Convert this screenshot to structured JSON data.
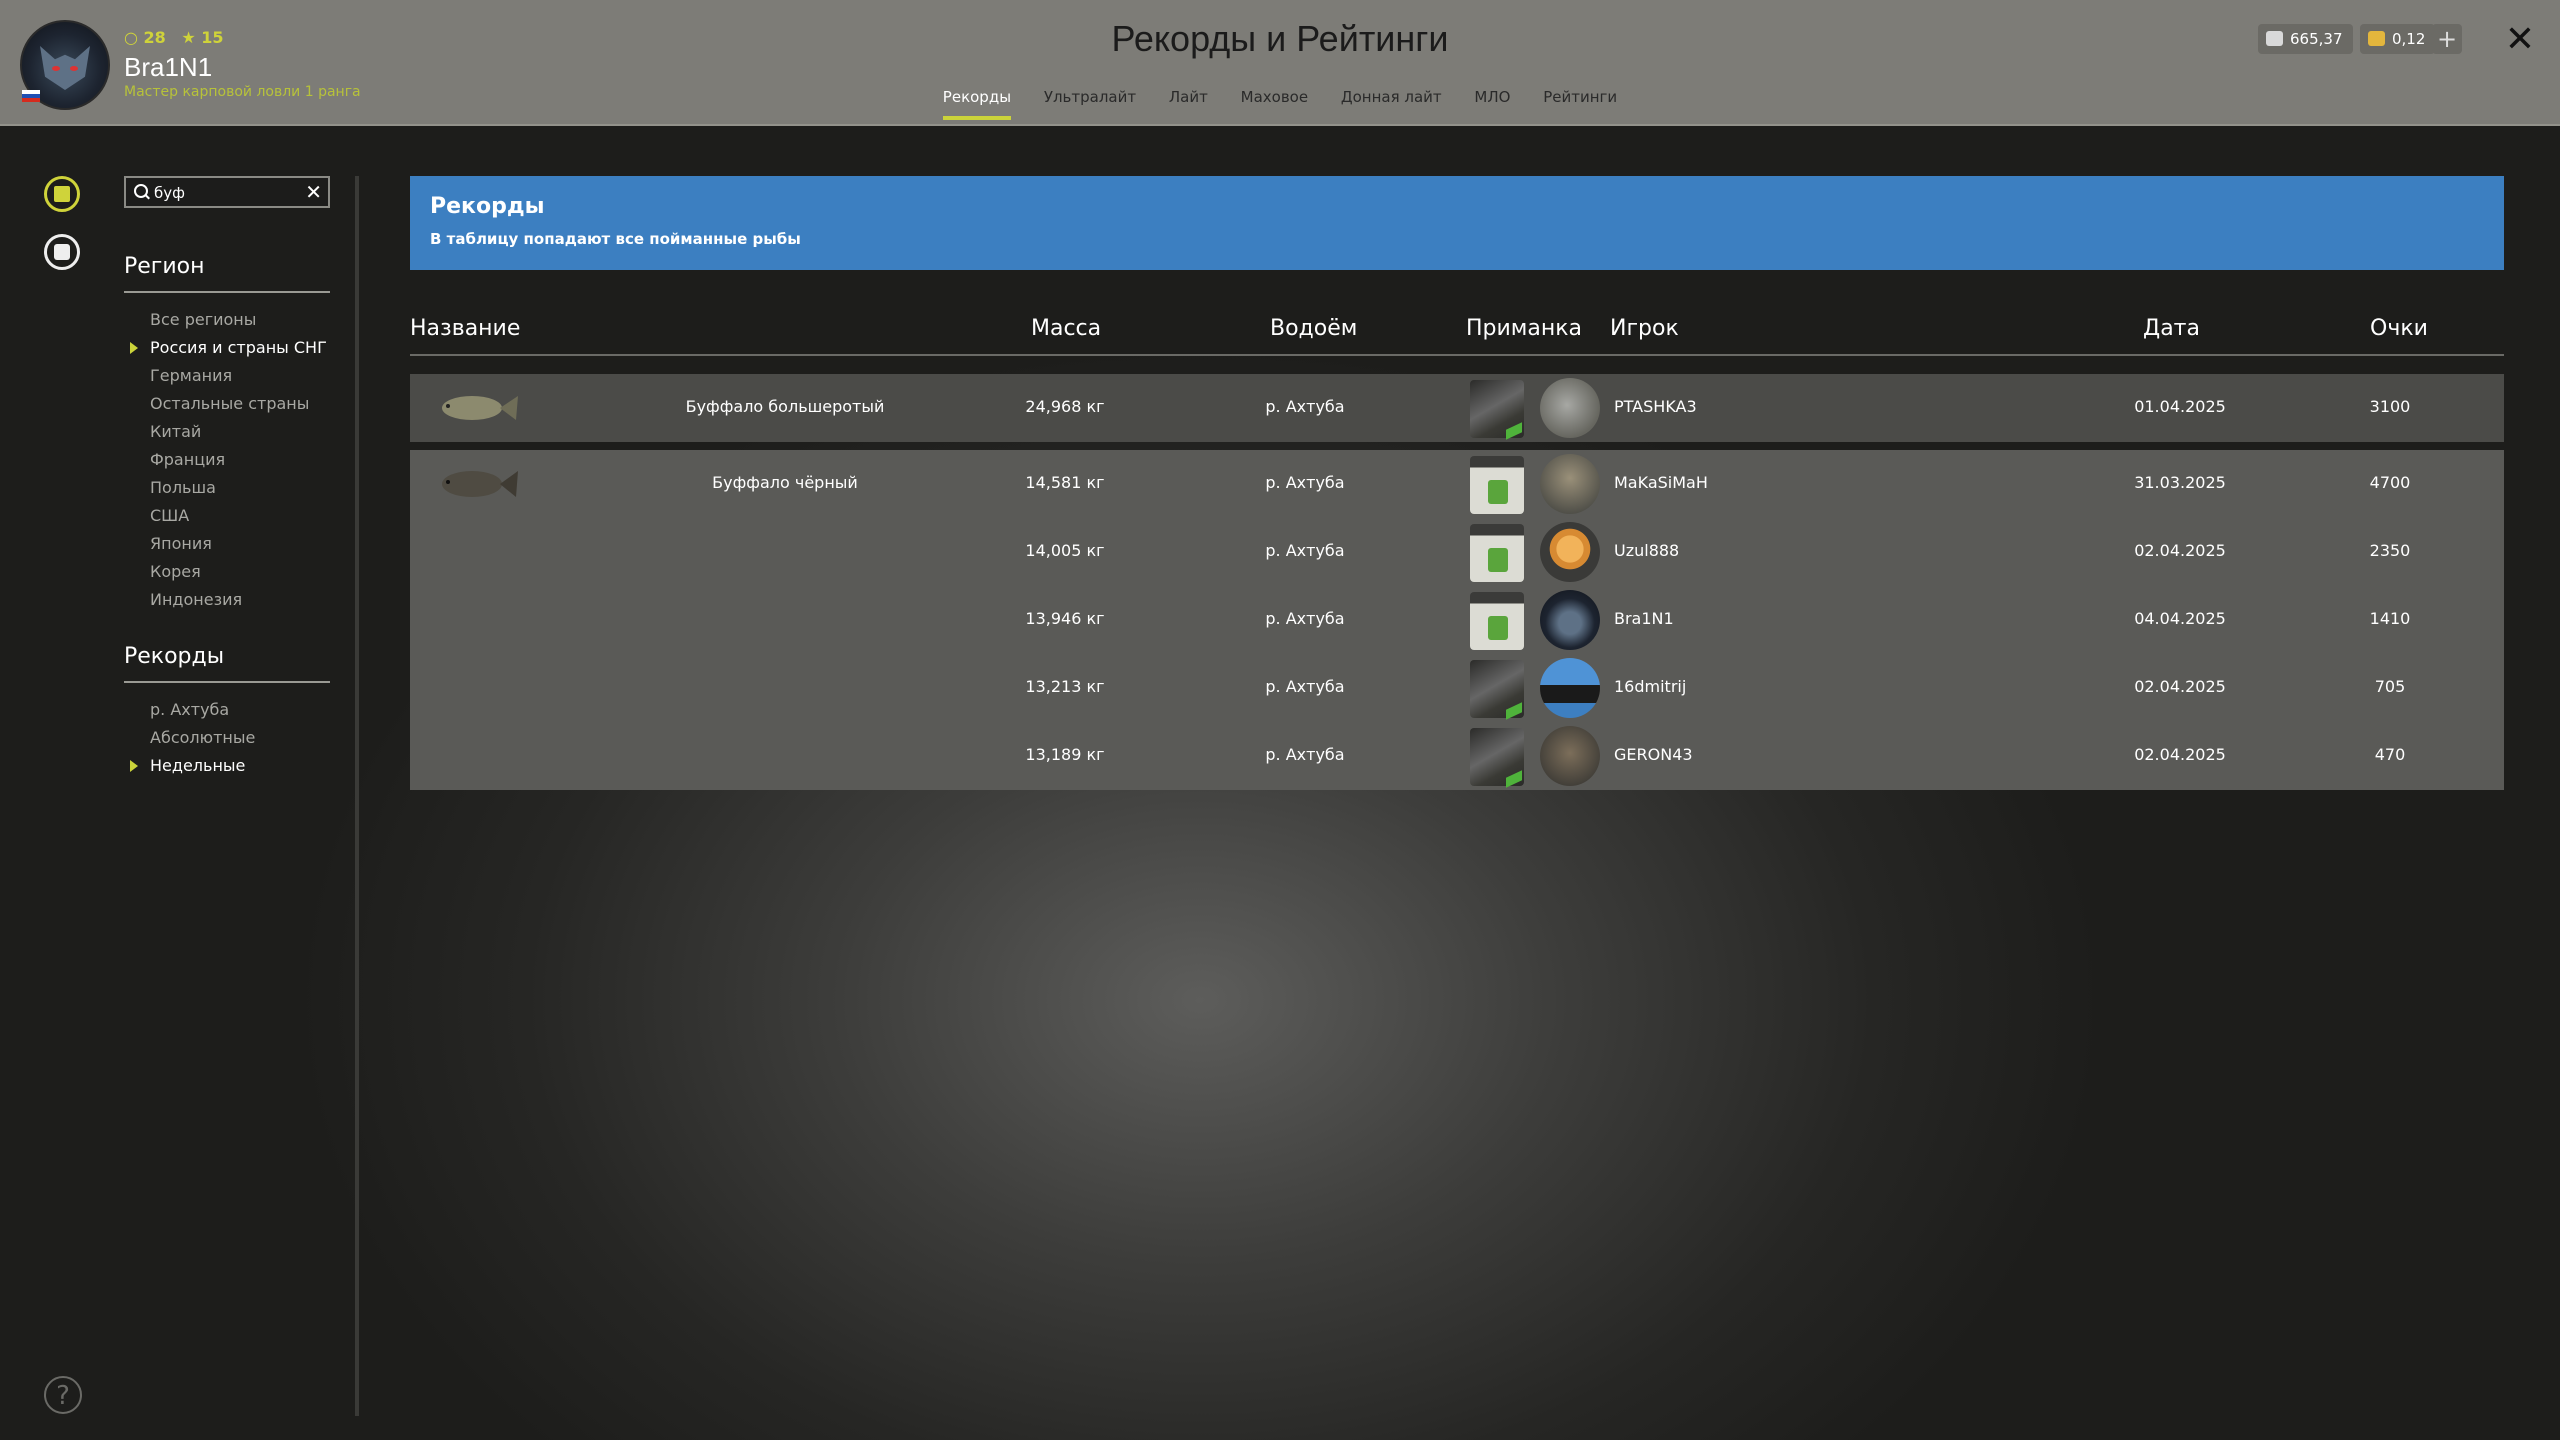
{
  "header": {
    "title": "Рекорды и Рейтинги",
    "user": {
      "name": "Bra1N1",
      "level": "28",
      "stars": "15",
      "rank": "Мастер карповой ловли 1 ранга"
    },
    "currency": {
      "silver": "665,37",
      "gold": "0,12"
    },
    "plus_label": "+",
    "close_label": "✕",
    "tabs": [
      {
        "label": "Рекорды",
        "active": true
      },
      {
        "label": "Ультралайт"
      },
      {
        "label": "Лайт"
      },
      {
        "label": "Маховое"
      },
      {
        "label": "Донная лайт"
      },
      {
        "label": "МЛО"
      },
      {
        "label": "Рейтинги"
      }
    ]
  },
  "sidebar": {
    "search": {
      "value": "буф",
      "clear": "✕"
    },
    "region_title": "Регион",
    "regions": [
      "Все регионы",
      "Россия и страны СНГ",
      "Германия",
      "Остальные страны",
      "Китай",
      "Франция",
      "Польша",
      "США",
      "Япония",
      "Корея",
      "Индонезия"
    ],
    "active_region": "Россия и страны СНГ",
    "records_title": "Рекорды",
    "records": [
      "р. Ахтуба",
      "Абсолютные",
      "Недельные"
    ],
    "active_record": "Недельные",
    "help": "?"
  },
  "banner": {
    "title": "Рекорды",
    "subtitle": "В таблицу попадают все пойманные рыбы"
  },
  "table": {
    "headers": {
      "name": "Название",
      "mass": "Масса",
      "water": "Водоём",
      "bait": "Приманка",
      "player": "Игрок",
      "date": "Дата",
      "points": "Очки"
    },
    "rows": [
      {
        "fish": "Буффало большеротый",
        "mass": "24,968 кг",
        "water": "р. Ахтуба",
        "bait": "dark-bait-pack",
        "player": "PTASHKA3",
        "date": "01.04.2025",
        "points": "3100"
      },
      {
        "fish": "Буффало чёрный",
        "mass": "14,581 кг",
        "water": "р. Ахтуба",
        "bait": "green-bait-jar",
        "player": "MaKaSiMaH",
        "date": "31.03.2025",
        "points": "4700"
      },
      {
        "fish": "",
        "mass": "14,005 кг",
        "water": "р. Ахтуба",
        "bait": "green-bait-jar",
        "player": "Uzul888",
        "date": "02.04.2025",
        "points": "2350"
      },
      {
        "fish": "",
        "mass": "13,946 кг",
        "water": "р. Ахтуба",
        "bait": "green-bait-jar",
        "player": "Bra1N1",
        "date": "04.04.2025",
        "points": "1410"
      },
      {
        "fish": "",
        "mass": "13,213 кг",
        "water": "р. Ахтуба",
        "bait": "dark-bait-pack",
        "player": "16dmitrij",
        "date": "02.04.2025",
        "points": "705"
      },
      {
        "fish": "",
        "mass": "13,189 кг",
        "water": "р. Ахтуба",
        "bait": "dark-bait-pack",
        "player": "GERON43",
        "date": "02.04.2025",
        "points": "470"
      }
    ]
  },
  "colors": {
    "accent": "#cbd33a",
    "banner": "#3c7fc1",
    "header": "#7d7c77"
  }
}
